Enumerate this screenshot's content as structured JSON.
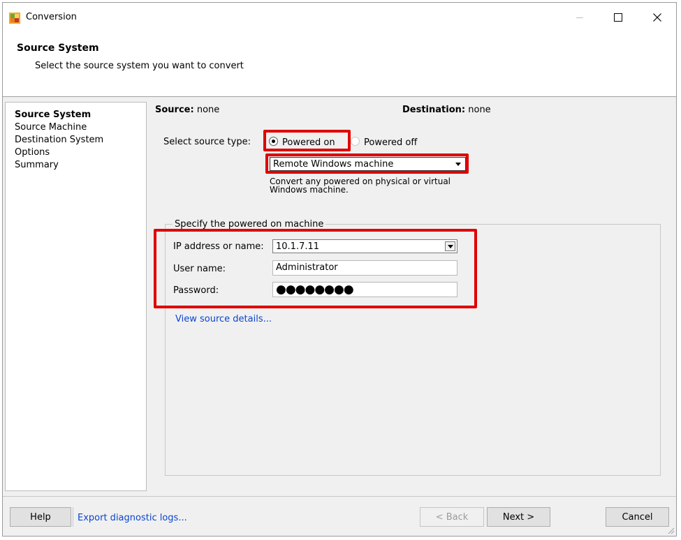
{
  "window": {
    "title": "Conversion",
    "icon": "vmware-converter-icon"
  },
  "header": {
    "title": "Source System",
    "subtitle": "Select the source system you want to convert"
  },
  "nav": {
    "items": [
      {
        "label": "Source System",
        "active": true
      },
      {
        "label": "Source Machine",
        "active": false
      },
      {
        "label": "Destination System",
        "active": false
      },
      {
        "label": "Options",
        "active": false
      },
      {
        "label": "Summary",
        "active": false
      }
    ]
  },
  "summary": {
    "source_label": "Source:",
    "source_value": "none",
    "destination_label": "Destination:",
    "destination_value": "none"
  },
  "source_type": {
    "label": "Select source type:",
    "options": [
      {
        "label": "Powered on",
        "selected": true
      },
      {
        "label": "Powered off",
        "selected": false
      }
    ],
    "machine_type": "Remote Windows machine",
    "description_line1": "Convert any powered on physical or virtual",
    "description_line2": "Windows machine."
  },
  "machine_group": {
    "legend": "Specify the powered on machine",
    "ip_label": "IP address or name:",
    "ip_value": "10.1.7.11",
    "user_label": "User name:",
    "user_value": "Administrator",
    "password_label": "Password:",
    "password_value": "●●●●●●●●",
    "details_link": "View source details..."
  },
  "footer": {
    "help": "Help",
    "export_logs": "Export diagnostic logs...",
    "back": "< Back",
    "next": "Next >",
    "cancel": "Cancel"
  },
  "colors": {
    "highlight": "#e00000",
    "link": "#0b44d0"
  }
}
